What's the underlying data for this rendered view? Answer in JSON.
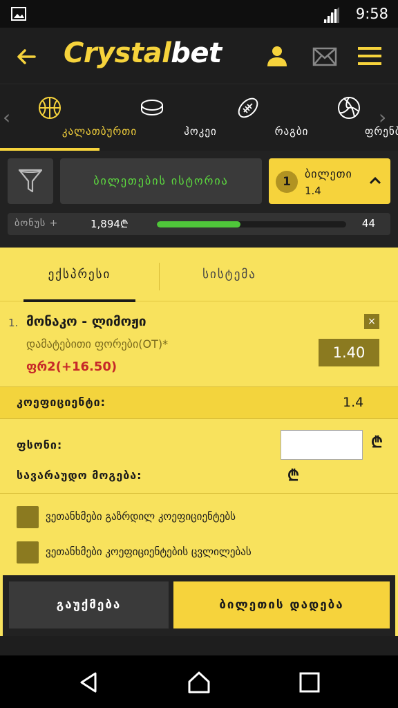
{
  "status": {
    "time": "9:58"
  },
  "header": {
    "brand_prefix": "Crystal",
    "brand_suffix": "bet"
  },
  "sports": [
    {
      "label": "კალათბურთი",
      "icon": "basketball-icon",
      "active": true
    },
    {
      "label": "ჰოკეი",
      "icon": "hockey-puck-icon",
      "active": false
    },
    {
      "label": "რაგბი",
      "icon": "rugby-ball-icon",
      "active": false
    },
    {
      "label": "ფრენბურთი",
      "icon": "volleyball-icon",
      "active": false
    }
  ],
  "toolbar": {
    "history_label": "ბილეთების ისტორია",
    "ticket_count": "1",
    "ticket_label": "ბილეთი",
    "ticket_odds": "1.4"
  },
  "bonus": {
    "label": "ბონუს +",
    "amount": "1,894₾",
    "count": "44",
    "progress": 0.44
  },
  "slip": {
    "tab_express": "ექსპრესი",
    "tab_system": "სისტემა",
    "bet": {
      "index": "1.",
      "match": "მონაკო - ლიმოჟი",
      "market": "დამატებითი ფორები(OT)*",
      "pick": "ფრ2(+16.50)",
      "odds": "1.40",
      "close": "×"
    },
    "coef_label": "კოეფიციენტი:",
    "coef_value": "1.4",
    "stake_label": "ფსონი:",
    "stake_value": "",
    "potential_label": "სავარაუდო მოგება:",
    "currency": "₾",
    "accept_increase": "ვეთანხმები გაზრდილ კოეფიციენტებს",
    "accept_change": "ვეთანხმები კოეფიციენტების ცვლილებას",
    "cancel_label": "გაუქმება",
    "place_label": "ბილეთის დადება"
  },
  "colors": {
    "accent": "#f6d33c",
    "slip_bg": "#f8e25d",
    "progress": "#4fc63a",
    "pick": "#c62828"
  }
}
